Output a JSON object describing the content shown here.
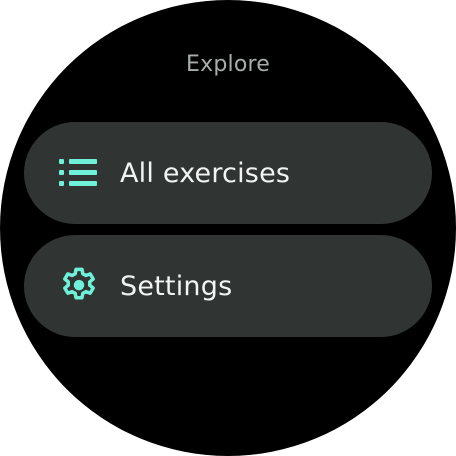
{
  "screen": {
    "title": "Explore"
  },
  "menu": {
    "items": [
      {
        "label": "All exercises",
        "icon": "list-icon"
      },
      {
        "label": "Settings",
        "icon": "gear-icon"
      }
    ]
  },
  "colors": {
    "background": "#000000",
    "chip": "#303533",
    "accent": "#6ff0d9",
    "title": "#a7adab",
    "label": "#f2f4f3"
  }
}
